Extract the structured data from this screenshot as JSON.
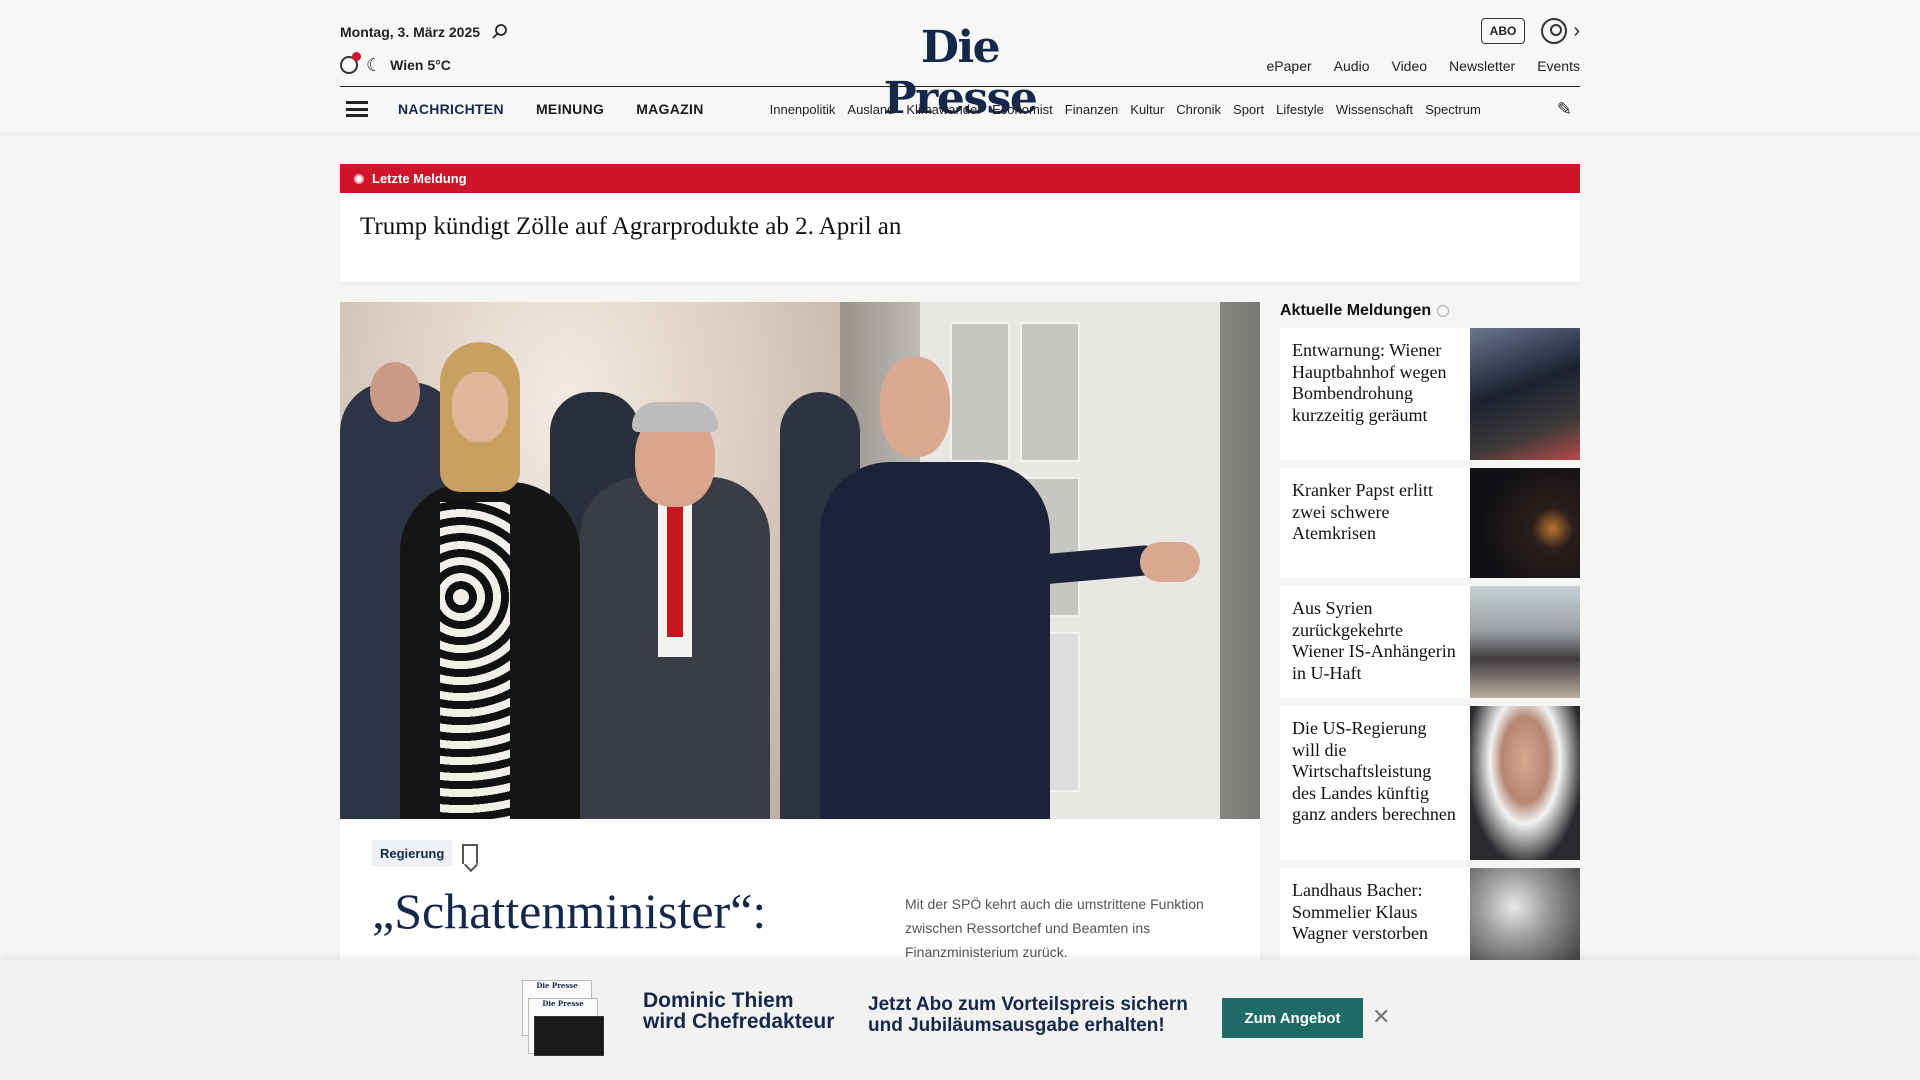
{
  "header": {
    "date": "Montag, 3. März 2025",
    "weather": "Wien 5°C",
    "logo": "Die Presse",
    "abo_label": "ABO",
    "links": [
      "ePaper",
      "Audio",
      "Video",
      "Newsletter",
      "Events"
    ]
  },
  "nav": {
    "main": [
      "NACHRICHTEN",
      "MEINUNG",
      "MAGAZIN"
    ],
    "sub": [
      "Innenpolitik",
      "Ausland",
      "Klimawandel",
      "Economist",
      "Finanzen",
      "Kultur",
      "Chronik",
      "Sport",
      "Lifestyle",
      "Wissenschaft",
      "Spectrum"
    ]
  },
  "breaking": {
    "label": "Letzte Meldung",
    "headline": "Trump kündigt Zölle auf Agrarprodukte ab 2. April an"
  },
  "hero": {
    "tag": "Regierung",
    "title": "„Schattenminister“:",
    "teaser": "Mit der SPÖ kehrt auch die umstrittene Funktion zwischen Ressortchef und Beamten ins Finanzministerium zurück."
  },
  "sidebar": {
    "title": "Aktuelle Meldungen",
    "items": [
      {
        "text": "Entwarnung: Wiener Hauptbahnhof wegen Bombendrohung kurzzeitig geräumt"
      },
      {
        "text": "Kranker Papst erlitt zwei schwere Atemkrisen"
      },
      {
        "text": "Aus Syrien zurückgekehrte Wiener IS-Anhängerin in U-Haft"
      },
      {
        "text": "Die US-Regierung will die Wirtschaftsleistung des Landes künftig ganz anders berechnen"
      },
      {
        "text": "Landhaus Bacher: Sommelier Klaus Wagner verstorben"
      }
    ]
  },
  "promo": {
    "title_line1": "Dominic Thiem",
    "title_line2": "wird Chefredakteur",
    "text_line1": "Jetzt Abo zum Vorteilspreis sichern",
    "text_line2": "und Jubiläumsausgabe erhalten!",
    "button": "Zum Angebot",
    "paper_logo": "Die Presse"
  },
  "colors": {
    "brand_navy": "#13284b",
    "breaking_red": "#d0142c",
    "button_teal": "#1e6b67"
  }
}
